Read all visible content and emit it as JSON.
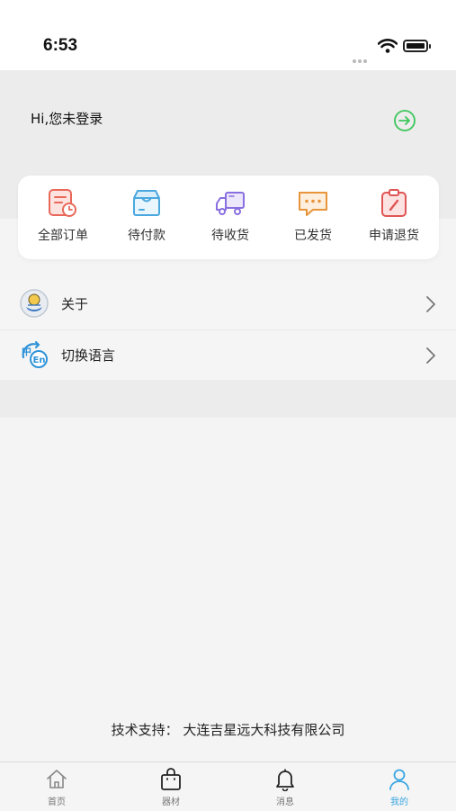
{
  "status_bar": {
    "time": "6:53"
  },
  "header": {
    "login_text": "Hi,您未登录",
    "login_icon": "arrow-right-circle-icon",
    "login_color": "#3bc65a"
  },
  "orders": {
    "items": [
      {
        "label": "全部订单",
        "icon": "order-list-icon",
        "color": "#e8685a"
      },
      {
        "label": "待付款",
        "icon": "box-icon",
        "color": "#4aa8df"
      },
      {
        "label": "待收货",
        "icon": "truck-icon",
        "color": "#8a6fe0"
      },
      {
        "label": "已发货",
        "icon": "chat-bubble-icon",
        "color": "#e8943a"
      },
      {
        "label": "申请退货",
        "icon": "clipboard-edit-icon",
        "color": "#e05555"
      }
    ]
  },
  "menu": {
    "items": [
      {
        "label": "关于",
        "icon": "about-logo-icon"
      },
      {
        "label": "切换语言",
        "icon": "language-switch-icon",
        "color": "#2f93d8"
      }
    ]
  },
  "footer": {
    "support_text": "技术支持：  大连吉星远大科技有限公司"
  },
  "tabbar": {
    "active_color": "#3aa6e2",
    "tabs": [
      {
        "label": "首页",
        "icon": "home-icon"
      },
      {
        "label": "器材",
        "icon": "shopping-bag-icon"
      },
      {
        "label": "消息",
        "icon": "bell-icon"
      },
      {
        "label": "我的",
        "icon": "user-icon",
        "active": true
      }
    ]
  }
}
